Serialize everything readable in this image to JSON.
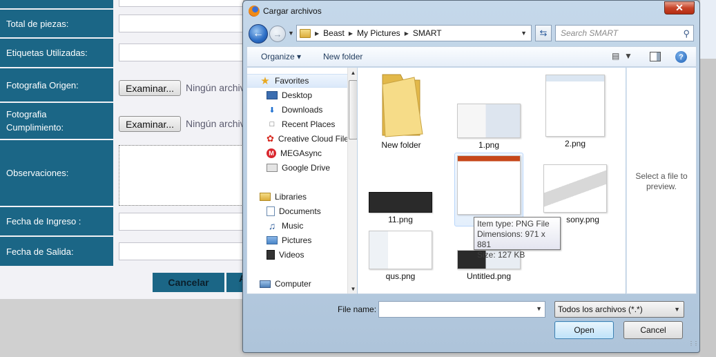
{
  "form": {
    "rows": [
      {
        "label": "Total de piezas:"
      },
      {
        "label": "Etiquetas Utilizadas:"
      },
      {
        "label": "Fotografia Origen:",
        "button": "Examinar...",
        "nofile": "Ningún archivo seleccionado."
      },
      {
        "label": "Fotografia Cumplimiento:",
        "button": "Examinar...",
        "nofile": "Ningún archivo seleccionado."
      },
      {
        "label": "Observaciones:"
      },
      {
        "label": "Fecha de Ingreso :"
      },
      {
        "label": "Fecha de Salida:"
      }
    ],
    "cancel_label": "Cancelar",
    "accept_label": "A"
  },
  "dialog": {
    "title": "Cargar archivos",
    "close_glyph": "✕",
    "breadcrumb": [
      "Beast",
      "My Pictures",
      "SMART"
    ],
    "search_placeholder": "Search SMART",
    "toolbar": {
      "organize": "Organize ▾",
      "new_folder": "New folder"
    },
    "nav": {
      "favorites_header": "Favorites",
      "favorites": [
        "Desktop",
        "Downloads",
        "Recent Places",
        "Creative Cloud Files",
        "MEGAsync",
        "Google Drive"
      ],
      "libraries_header": "Libraries",
      "libraries": [
        "Documents",
        "Music",
        "Pictures",
        "Videos"
      ],
      "computer_header": "Computer"
    },
    "files": [
      {
        "name": "New folder",
        "kind": "folder"
      },
      {
        "name": "1.png",
        "kind": "image"
      },
      {
        "name": "2.png",
        "kind": "image"
      },
      {
        "name": "",
        "kind": "image"
      },
      {
        "name": "11.png",
        "kind": "image"
      },
      {
        "name": "sony.png",
        "kind": "image"
      },
      {
        "name": "qus.png",
        "kind": "image"
      },
      {
        "name": "Untitled.png",
        "kind": "image"
      }
    ],
    "tooltip": {
      "type": "Item type: PNG File",
      "dimensions": "Dimensions: 971 x 881",
      "size": "Size: 127 KB"
    },
    "preview_text": "Select a file to preview.",
    "file_name_label": "File name:",
    "file_name_value": "",
    "filter": "Todos los archivos (*.*)",
    "open_label": "Open",
    "cancel_label": "Cancel"
  }
}
